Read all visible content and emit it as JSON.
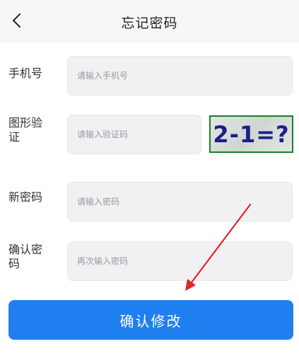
{
  "header": {
    "title": "忘记密码",
    "back_icon": "chevron-left-icon"
  },
  "form": {
    "phone": {
      "label": "手机号",
      "placeholder": "请输入手机号",
      "value": ""
    },
    "captcha": {
      "label": "图形验证",
      "placeholder": "请输入验证码",
      "value": "",
      "image_text": "2-1=?"
    },
    "new_password": {
      "label": "新密码",
      "placeholder": "请输入密码",
      "value": ""
    },
    "confirm_password": {
      "label": "确认密码",
      "placeholder": "再次输入密码",
      "value": ""
    }
  },
  "submit": {
    "label": "确认修改"
  },
  "colors": {
    "primary": "#1f7ff0",
    "header_bg": "#f7f7f7",
    "input_bg": "#f1f1f3",
    "annotation_arrow": "#e0252a",
    "captcha_text": "#1a1f8a"
  }
}
